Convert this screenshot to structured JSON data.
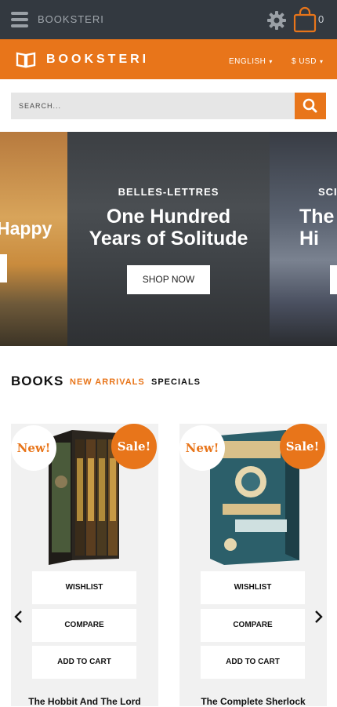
{
  "topbar": {
    "brand": "BOOKSTERI",
    "cart_count": "0"
  },
  "header": {
    "logo_text": "BOOKSTERI",
    "language": "ENGLISH",
    "currency": "$ USD"
  },
  "search": {
    "placeholder": "SEARCH..."
  },
  "slider": {
    "left_slide_title": "Happy",
    "main_slide": {
      "category": "BELLES-LETTRES",
      "title_line1": "One Hundred",
      "title_line2": "Years of Solitude",
      "button": "SHOP NOW"
    },
    "right_slide": {
      "category": "SCI",
      "title_line1": "The",
      "title_line2": "Hi"
    }
  },
  "tabs": {
    "title": "BOOKS",
    "items": [
      "NEW ARRIVALS",
      "SPECIALS"
    ],
    "active": "NEW ARRIVALS"
  },
  "products": [
    {
      "name": "The Hobbit And The Lord",
      "badge_new": "New!",
      "badge_sale": "Sale!",
      "wishlist": "WISHLIST",
      "compare": "COMPARE",
      "add_to_cart": "ADD TO CART"
    },
    {
      "name": "The Complete Sherlock",
      "badge_new": "New!",
      "badge_sale": "Sale!",
      "wishlist": "WISHLIST",
      "compare": "COMPARE",
      "add_to_cart": "ADD TO CART"
    }
  ],
  "colors": {
    "accent": "#e8751a",
    "topbar": "#333940",
    "card_bg": "#f1f1f1"
  },
  "icons": [
    "menu-icon",
    "gear-icon",
    "cart-icon",
    "book-logo-icon",
    "search-icon",
    "chevron-down-icon",
    "chevron-left-icon",
    "chevron-right-icon"
  ]
}
